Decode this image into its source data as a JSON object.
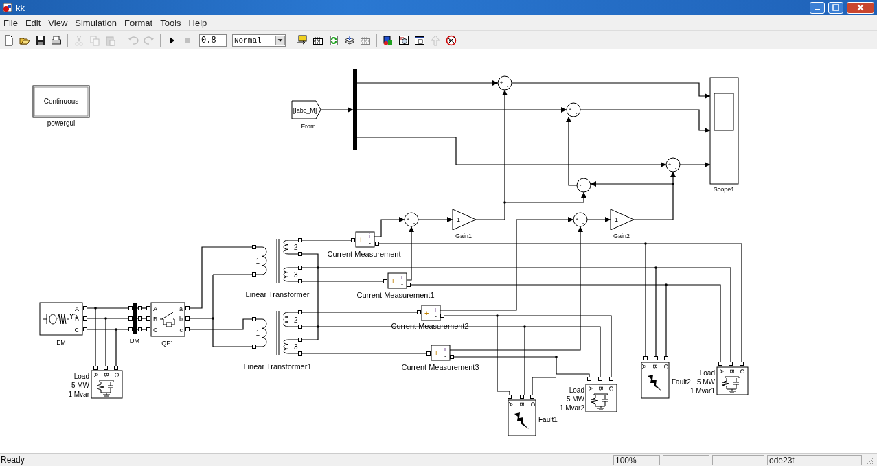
{
  "window": {
    "title": "kk"
  },
  "menu": [
    "File",
    "Edit",
    "View",
    "Simulation",
    "Format",
    "Tools",
    "Help"
  ],
  "toolbar": {
    "left": [
      {
        "kind": "new",
        "disabled": false
      },
      {
        "kind": "open",
        "disabled": false
      },
      {
        "kind": "save",
        "disabled": false
      },
      {
        "kind": "print",
        "disabled": false
      },
      {
        "kind": "sep"
      },
      {
        "kind": "cut",
        "disabled": true
      },
      {
        "kind": "copy",
        "disabled": true
      },
      {
        "kind": "paste",
        "disabled": true
      },
      {
        "kind": "sep"
      },
      {
        "kind": "undo",
        "disabled": true
      },
      {
        "kind": "redo",
        "disabled": true
      },
      {
        "kind": "sep"
      },
      {
        "kind": "play",
        "disabled": false
      },
      {
        "kind": "stop",
        "disabled": true
      }
    ],
    "stop_time": "0.8",
    "sim_mode": "Normal",
    "right": [
      {
        "kind": "sep"
      },
      {
        "kind": "label",
        "disabled": false
      },
      {
        "kind": "grid",
        "disabled": false
      },
      {
        "kind": "refresh",
        "disabled": false
      },
      {
        "kind": "layers",
        "disabled": false
      },
      {
        "kind": "grid",
        "disabled": true
      },
      {
        "kind": "sep"
      },
      {
        "kind": "library",
        "disabled": false
      },
      {
        "kind": "explorer",
        "disabled": false
      },
      {
        "kind": "window",
        "disabled": false
      },
      {
        "kind": "up",
        "disabled": true
      },
      {
        "kind": "debug",
        "disabled": false
      }
    ]
  },
  "diagram": {
    "powergui": {
      "text": "Continuous",
      "label": "powergui"
    },
    "from": {
      "tag": "[Iabc_M]",
      "label": "From"
    },
    "scope": {
      "label": "Scope1"
    },
    "sums": [
      {
        "signs": [
          "+",
          "-"
        ]
      },
      {
        "signs": [
          "+",
          "-"
        ]
      },
      {
        "signs": [
          "+",
          "-"
        ]
      },
      {
        "signs": [
          "-",
          "-"
        ]
      },
      {
        "signs": [
          "+",
          "-"
        ]
      },
      {
        "signs": [
          "+",
          "-"
        ]
      }
    ],
    "gains": [
      {
        "value": "1",
        "label": "Gain1"
      },
      {
        "value": "1",
        "label": "Gain2"
      }
    ],
    "source": {
      "label": "EM",
      "ports": [
        "A",
        "B",
        "C"
      ]
    },
    "bus": {
      "label": "UM"
    },
    "breaker": {
      "label": "QF1",
      "ports_in": [
        "A",
        "B",
        "C"
      ],
      "ports_out": [
        "a",
        "b",
        "c"
      ]
    },
    "transformers": [
      {
        "label": "Linear Transformer",
        "windings": [
          "1",
          "2",
          "3"
        ]
      },
      {
        "label": "Linear Transformer1",
        "windings": [
          "1",
          "2",
          "3"
        ]
      }
    ],
    "current_measurements": [
      {
        "label": "Current Measurement",
        "plus": "+",
        "output": "i",
        "minus": "-"
      },
      {
        "label": "Current Measurement1",
        "plus": "+",
        "output": "i",
        "minus": "-"
      },
      {
        "label": "Current Measurement2",
        "plus": "+",
        "output": "i",
        "minus": "-"
      },
      {
        "label": "Current Measurement3",
        "plus": "+",
        "output": "i",
        "minus": "-"
      }
    ],
    "loads": [
      {
        "lines": [
          "Load",
          "5 MW",
          "1 Mvar"
        ],
        "ports": [
          "A",
          "B",
          "C"
        ]
      },
      {
        "lines": [
          "Load",
          "5 MW",
          "1 Mvar2"
        ],
        "ports": [
          "A",
          "B",
          "C"
        ]
      },
      {
        "lines": [
          "Load",
          "5 MW",
          "1 Mvar1"
        ],
        "ports": [
          "A",
          "B",
          "C"
        ]
      }
    ],
    "faults": [
      {
        "label": "Fault1",
        "ports": [
          "A",
          "B",
          "C"
        ]
      },
      {
        "label": "Fault2",
        "ports": [
          "A",
          "B",
          "C"
        ]
      }
    ]
  },
  "status_bar": {
    "status": "Ready",
    "zoom": "100%",
    "solver": "ode23t"
  }
}
